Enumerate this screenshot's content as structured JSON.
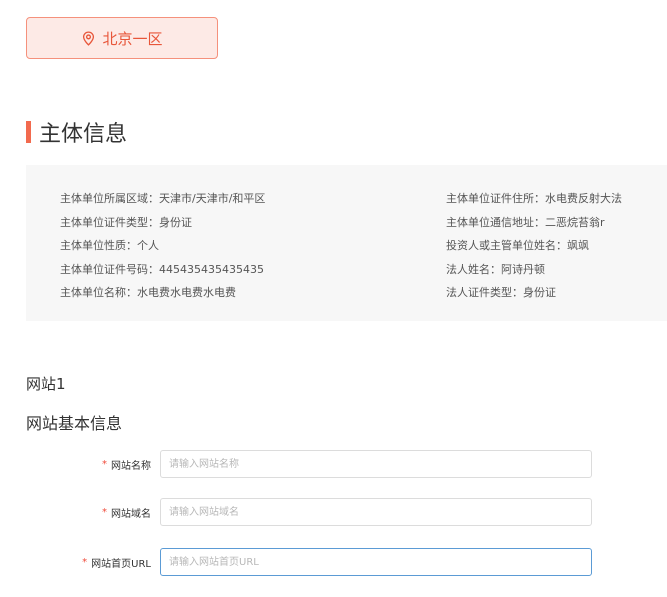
{
  "region": {
    "label": "北京一区",
    "icon": "location-pin-icon",
    "color": "#e8563a"
  },
  "section": {
    "title": "主体信息"
  },
  "info": {
    "left": [
      "主体单位所属区域：天津市/天津市/和平区",
      "主体单位证件类型：身份证",
      "主体单位性质：个人",
      "主体单位证件号码：445435435435435",
      "主体单位名称：水电费水电费水电费"
    ],
    "right": [
      "主体单位证件住所：水电费反射大法",
      "主体单位通信地址：二恶烷苔翁r",
      "投资人或主管单位姓名：飒飒",
      "法人姓名：阿诗丹顿",
      "法人证件类型：身份证"
    ]
  },
  "website": {
    "label": "网站1",
    "basic_title": "网站基本信息",
    "required_mark": "*",
    "fields": [
      {
        "label": "网站名称",
        "placeholder": "请输入网站名称",
        "value": ""
      },
      {
        "label": "网站域名",
        "placeholder": "请输入网站域名",
        "value": ""
      },
      {
        "label": "网站首页URL",
        "placeholder": "请输入网站首页URL",
        "value": ""
      }
    ]
  }
}
